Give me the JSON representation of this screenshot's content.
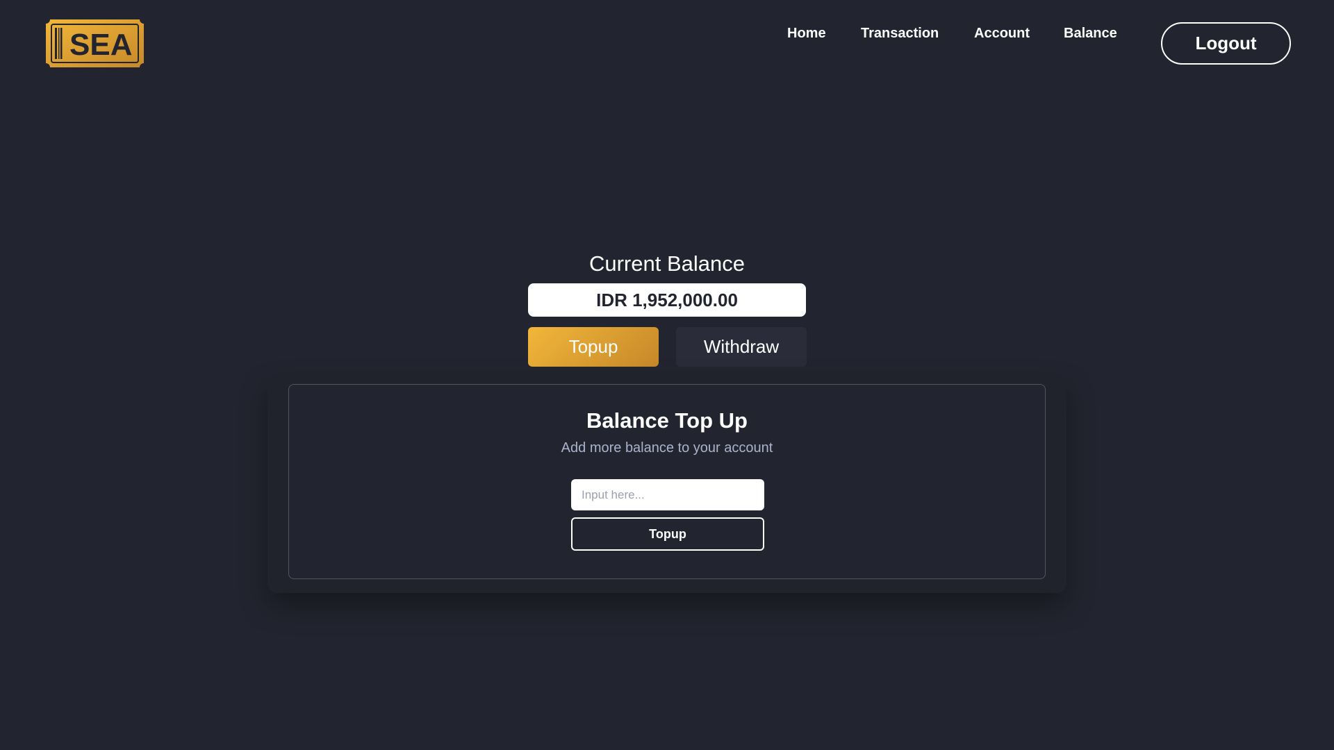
{
  "brand": {
    "logo_text": "SEA",
    "logo_colors": {
      "gold_light": "#f2b63a",
      "gold_dark": "#c6892a",
      "ink": "#22252f"
    }
  },
  "nav": {
    "items": [
      {
        "label": "Home"
      },
      {
        "label": "Transaction"
      },
      {
        "label": "Account"
      },
      {
        "label": "Balance"
      }
    ],
    "logout_label": "Logout"
  },
  "balance": {
    "title": "Current Balance",
    "amount": "IDR 1,952,000.00",
    "tabs": {
      "topup_label": "Topup",
      "withdraw_label": "Withdraw",
      "active": "topup"
    }
  },
  "topup_card": {
    "title": "Balance Top Up",
    "subtitle": "Add more balance to your account",
    "input": {
      "value": "",
      "placeholder": "Input here..."
    },
    "submit_label": "Topup"
  },
  "theme": {
    "background": "#22252f",
    "accent": "#f2b63a",
    "subtitle_color": "#a9b4cc"
  }
}
